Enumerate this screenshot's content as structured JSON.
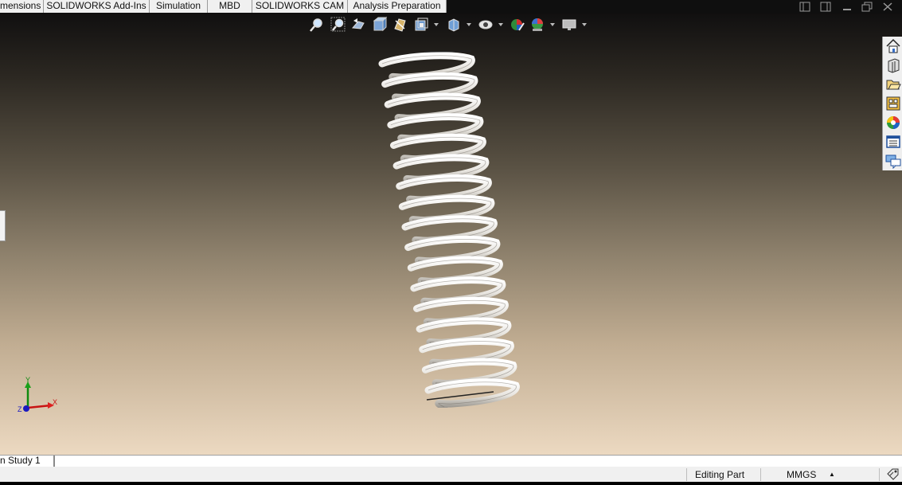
{
  "command_manager": {
    "tabs": [
      {
        "label": "mensions"
      },
      {
        "label": "SOLIDWORKS Add-Ins"
      },
      {
        "label": "Simulation"
      },
      {
        "label": "MBD"
      },
      {
        "label": "SOLIDWORKS CAM"
      },
      {
        "label": "Analysis Preparation"
      }
    ]
  },
  "heads_up_toolbar": {
    "icons": [
      "zoom-to-fit-icon",
      "zoom-to-area-icon",
      "previous-view-icon",
      "section-view-icon",
      "dynamic-annotation-views-icon",
      "view-orientation-icon",
      "display-style-icon",
      "hide-show-items-icon",
      "edit-appearance-icon",
      "apply-scene-icon",
      "view-settings-icon"
    ]
  },
  "task_pane": {
    "icons": [
      "solidworks-resources-icon",
      "design-library-icon",
      "file-explorer-icon",
      "view-palette-icon",
      "appearances-scenes-icon",
      "custom-properties-icon",
      "forum-icon"
    ]
  },
  "triad": {
    "x_label": "X",
    "y_label": "Y",
    "z_label": "Z",
    "colors": {
      "x": "#d01010",
      "y": "#109010",
      "z": "#1010c0"
    }
  },
  "bottom_tabs": {
    "study_tab": "n Study 1"
  },
  "status_bar": {
    "mode": "Editing Part",
    "units": "MMGS",
    "units_caret": "▲"
  }
}
